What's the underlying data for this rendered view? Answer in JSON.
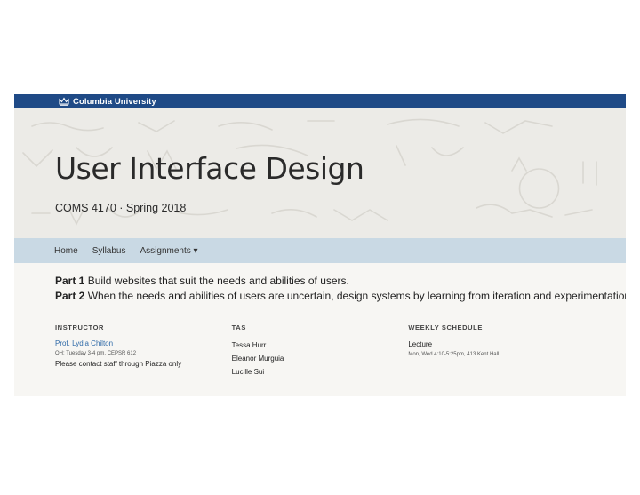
{
  "university": "Columbia University",
  "hero": {
    "title": "User Interface Design",
    "subtitle": "COMS 4170 · Spring 2018"
  },
  "nav": {
    "home": "Home",
    "syllabus": "Syllabus",
    "assignments": "Assignments ▾"
  },
  "parts": [
    {
      "label": "Part 1",
      "text": "Build websites that suit the needs and abilities of users."
    },
    {
      "label": "Part 2",
      "text": "When the needs and abilities of users are uncertain, design systems by learning from iteration and experimentation."
    }
  ],
  "instructor": {
    "heading": "INSTRUCTOR",
    "name": "Prof. Lydia Chilton",
    "office_hours": "OH: Tuesday 3-4 pm, CEPSR 612",
    "note": "Please contact staff through Piazza only"
  },
  "tas": {
    "heading": "TAS",
    "names": [
      "Tessa Hurr",
      "Eleanor Murguia",
      "Lucille Sui"
    ]
  },
  "schedule": {
    "heading": "WEEKLY SCHEDULE",
    "item": "Lecture",
    "detail": "Mon, Wed 4:10-5:25pm, 413 Kent Hall"
  },
  "colors": {
    "topbar": "#1f4a86",
    "nav": "#c9d9e4",
    "link": "#2f6aa8"
  }
}
